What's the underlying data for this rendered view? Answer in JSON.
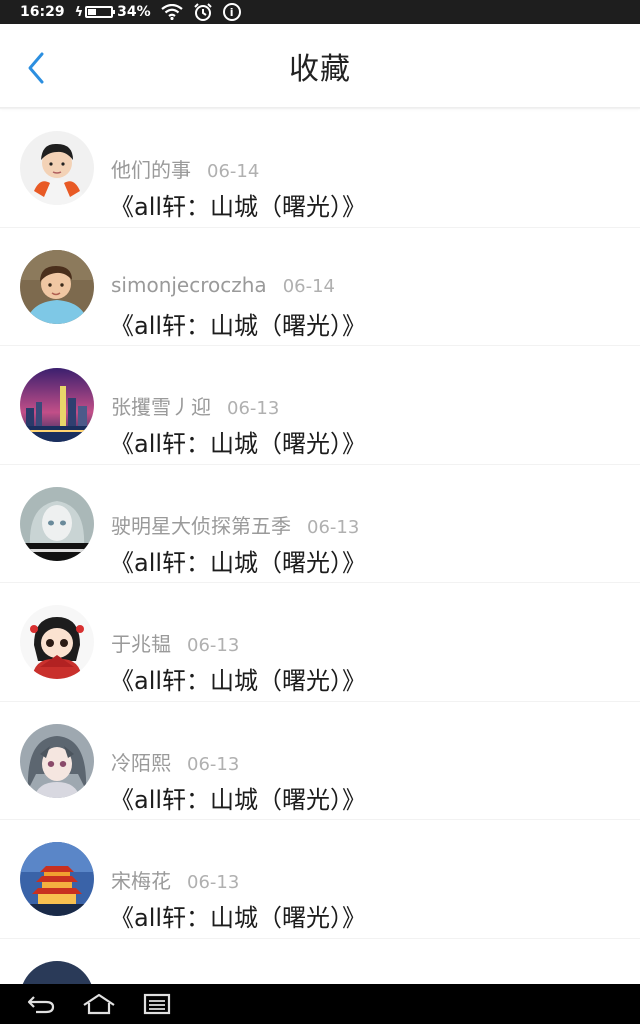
{
  "status_bar": {
    "time": "16:29",
    "battery_percent": "34%",
    "battery_level": 0.34,
    "icons": [
      "charging-bolt-icon",
      "battery-icon",
      "wifi-icon",
      "alarm-icon",
      "info-icon"
    ]
  },
  "header": {
    "title": "收藏",
    "back_icon": "chevron-left-icon",
    "accent": "#2c8fe0"
  },
  "favorites": [
    {
      "user": "他们的事",
      "date": "06-14",
      "title": "《all轩：山城（曙光）》",
      "avatar": "boy-red-scarf"
    },
    {
      "user": "simonjecroczha",
      "date": "06-14",
      "title": "《all轩：山城（曙光）》",
      "avatar": "child-outdoor"
    },
    {
      "user": "张攫雪丿迎",
      "date": "06-13",
      "title": "《all轩：山城（曙光）》",
      "avatar": "city-night"
    },
    {
      "user": "驶明星大侦探第五季",
      "date": "06-13",
      "title": "《all轩：山城（曙光）》",
      "avatar": "anime-girl-caption"
    },
    {
      "user": "于兆韫",
      "date": "06-13",
      "title": "《all轩：山城（曙光）》",
      "avatar": "chibi-fan"
    },
    {
      "user": "冷陌熙",
      "date": "06-13",
      "title": "《all轩：山城（曙光）》",
      "avatar": "anime-girl-grey"
    },
    {
      "user": "宋梅花",
      "date": "06-13",
      "title": "《all轩：山城（曙光）》",
      "avatar": "pagoda-night"
    }
  ],
  "nav_bar": {
    "icons": [
      "back-arrow-icon",
      "home-icon",
      "recent-apps-icon"
    ]
  }
}
